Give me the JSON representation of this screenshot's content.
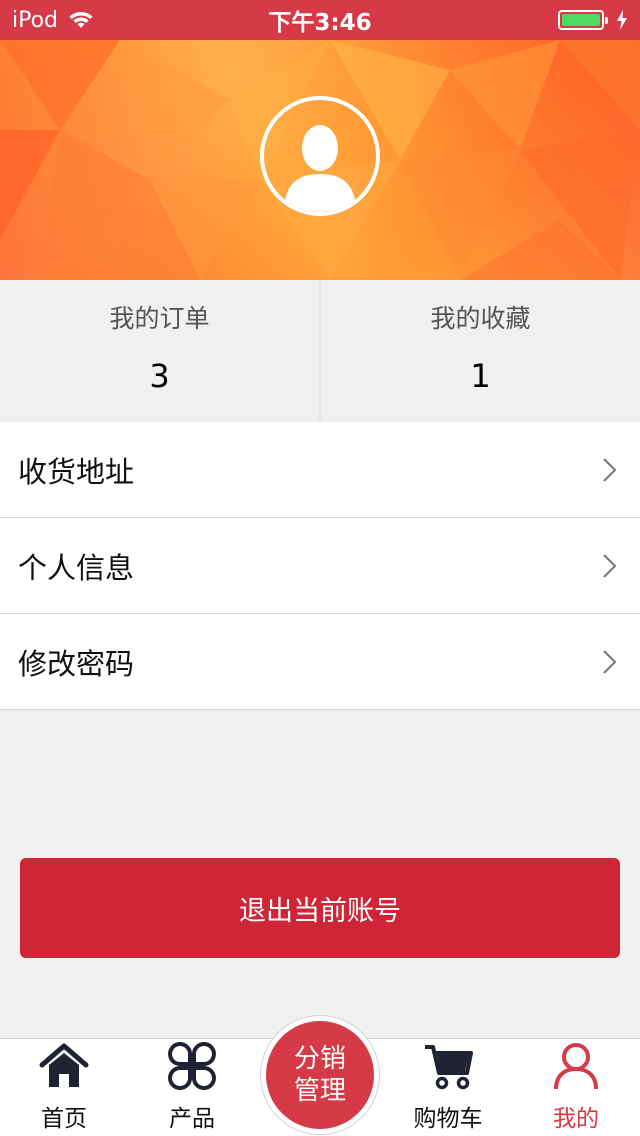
{
  "status_bar": {
    "carrier": "iPod",
    "time": "下午3:46"
  },
  "profile": {
    "avatar_icon": "user-silhouette-icon"
  },
  "stats": [
    {
      "label": "我的订单",
      "value": "3"
    },
    {
      "label": "我的收藏",
      "value": "1"
    }
  ],
  "menu": [
    {
      "label": "收货地址"
    },
    {
      "label": "个人信息"
    },
    {
      "label": "修改密码"
    }
  ],
  "logout_label": "退出当前账号",
  "tabbar": {
    "home": "首页",
    "products": "产品",
    "center_line1": "分销",
    "center_line2": "管理",
    "cart": "购物车",
    "mine": "我的"
  },
  "colors": {
    "accent": "#d63a47",
    "button": "#ce2637",
    "banner": "#ff8a33",
    "battery": "#4cd964"
  }
}
